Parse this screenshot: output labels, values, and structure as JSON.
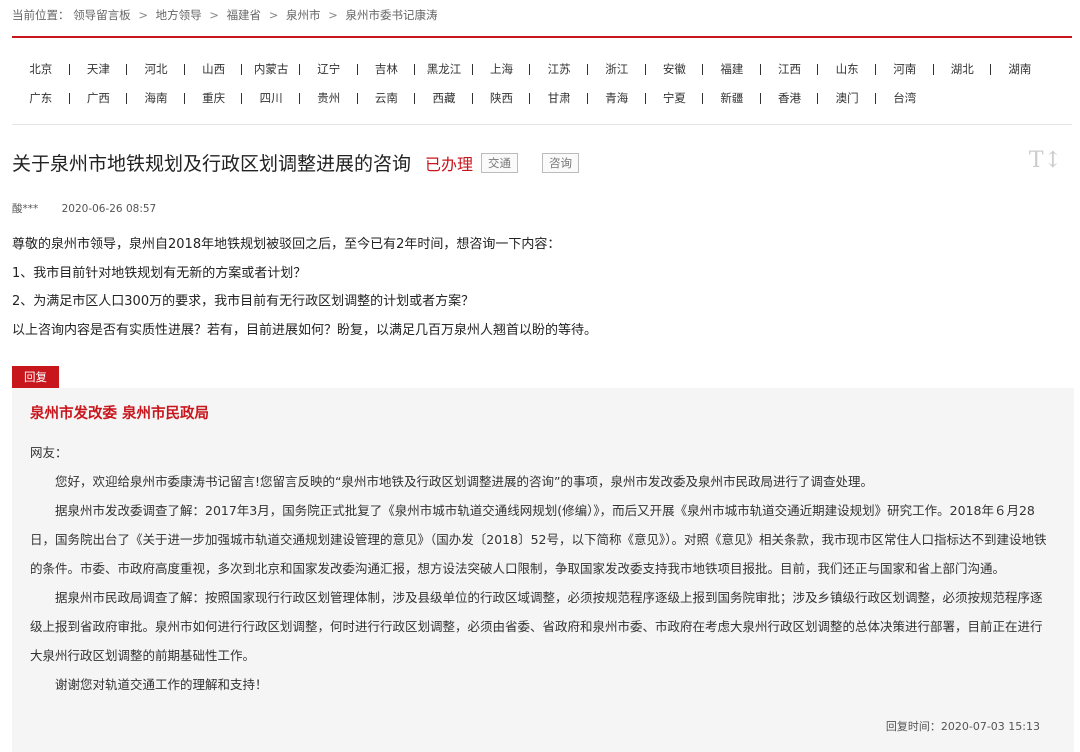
{
  "breadcrumb": {
    "label": "当前位置：",
    "items": [
      "领导留言板",
      "地方领导",
      "福建省",
      "泉州市",
      "泉州市委书记康涛"
    ],
    "separator": ">"
  },
  "regions": {
    "row1": [
      "北京",
      "天津",
      "河北",
      "山西",
      "内蒙古",
      "辽宁",
      "吉林",
      "黑龙江",
      "上海",
      "江苏",
      "浙江",
      "安徽",
      "福建",
      "江西",
      "山东",
      "河南",
      "湖北",
      "湖南"
    ],
    "row2": [
      "广东",
      "广西",
      "海南",
      "重庆",
      "四川",
      "贵州",
      "云南",
      "西藏",
      "陕西",
      "甘肃",
      "青海",
      "宁夏",
      "新疆",
      "香港",
      "澳门",
      "台湾"
    ]
  },
  "message": {
    "title": "关于泉州市地铁规划及行政区划调整进展的咨询",
    "status": "已办理",
    "tags": [
      "交通",
      "咨询"
    ],
    "author": "酸***",
    "time": "2020-06-26 08:57",
    "body": [
      "尊敬的泉州市领导，泉州自2018年地铁规划被驳回之后，至今已有2年时间，想咨询一下内容：",
      "1、我市目前针对地铁规划有无新的方案或者计划？",
      "2、为满足市区人口300万的要求，我市目前有无行政区划调整的计划或者方案？",
      "以上咨询内容是否有实质性进展？若有，目前进展如何？盼复，以满足几百万泉州人翘首以盼的等待。"
    ]
  },
  "reply": {
    "badge": "回复",
    "org": "泉州市发改委 泉州市民政局",
    "greeting": "网友：",
    "paragraphs": [
      "您好，欢迎给泉州市委康涛书记留言!您留言反映的“泉州市地铁及行政区划调整进展的咨询”的事项，泉州市发改委及泉州市民政局进行了调查处理。",
      "据泉州市发改委调查了解：2017年3月，国务院正式批复了《泉州市城市轨道交通线网规划(修编）》，而后又开展《泉州市城市轨道交通近期建设规划》研究工作。2018年６月28日，国务院出台了《关于进一步加强城市轨道交通规划建设管理的意见》（国办发〔2018〕52号，以下简称《意见》）。对照《意见》相关条款，我市现市区常住人口指标达不到建设地铁的条件。市委、市政府高度重视，多次到北京和国家发改委沟通汇报，想方设法突破人口限制，争取国家发改委支持我市地铁项目报批。目前，我们还正与国家和省上部门沟通。",
      "据泉州市民政局调查了解：按照国家现行行政区划管理体制，涉及县级单位的行政区域调整，必须按规范程序逐级上报到国务院审批；涉及乡镇级行政区划调整，必须按规范程序逐级上报到省政府审批。泉州市如何进行行政区划调整，何时进行行政区划调整，必须由省委、省政府和泉州市委、市政府在考虑大泉州行政区划调整的总体决策进行部署，目前正在进行大泉州行政区划调整的前期基础性工作。",
      "谢谢您对轨道交通工作的理解和支持！"
    ],
    "time_label": "回复时间：",
    "time": "2020-07-03 15:13"
  },
  "icons": {
    "font_size": "font-size-icon"
  },
  "colors": {
    "accent": "#c8161d"
  }
}
